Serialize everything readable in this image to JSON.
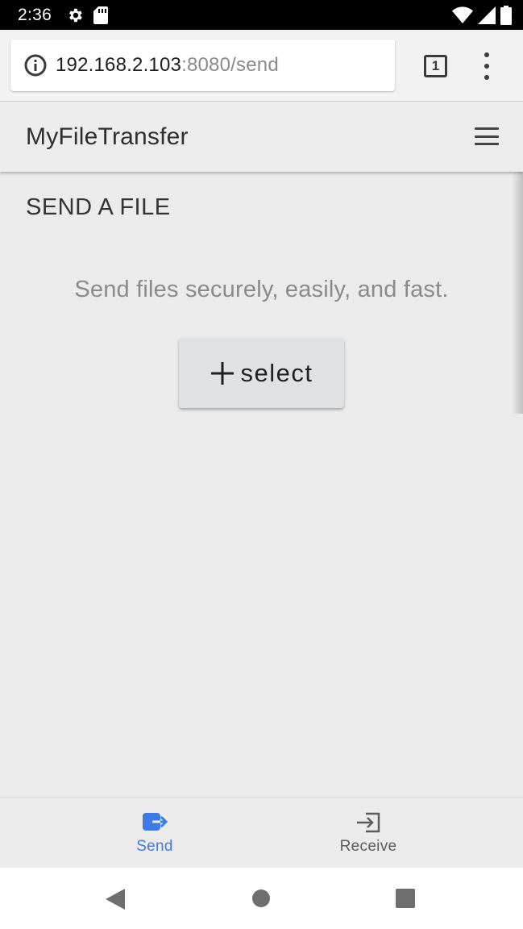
{
  "status_bar": {
    "time": "2:36",
    "icons": [
      "settings-icon",
      "sd-card-icon",
      "wifi-icon",
      "signal-icon",
      "battery-icon"
    ]
  },
  "browser": {
    "url_host": "192.168.2.103",
    "url_rest": ":8080/send",
    "tab_count": "1",
    "icons": [
      "info-icon",
      "tab-switcher-icon",
      "overflow-menu-icon"
    ]
  },
  "header": {
    "title": "MyFileTransfer",
    "menu_icon": "hamburger-icon"
  },
  "main": {
    "section_title": "SEND A FILE",
    "tagline": "Send files securely, easily, and fast.",
    "select_button_label": "select",
    "select_button_icon": "plus-icon"
  },
  "bottom_nav": {
    "items": [
      {
        "label": "Send",
        "icon": "send-icon",
        "active": true
      },
      {
        "label": "Receive",
        "icon": "receive-icon",
        "active": false
      }
    ],
    "accent_color": "#3b7be6"
  },
  "system_nav": {
    "icons": [
      "back-icon",
      "home-icon",
      "recents-icon"
    ]
  }
}
